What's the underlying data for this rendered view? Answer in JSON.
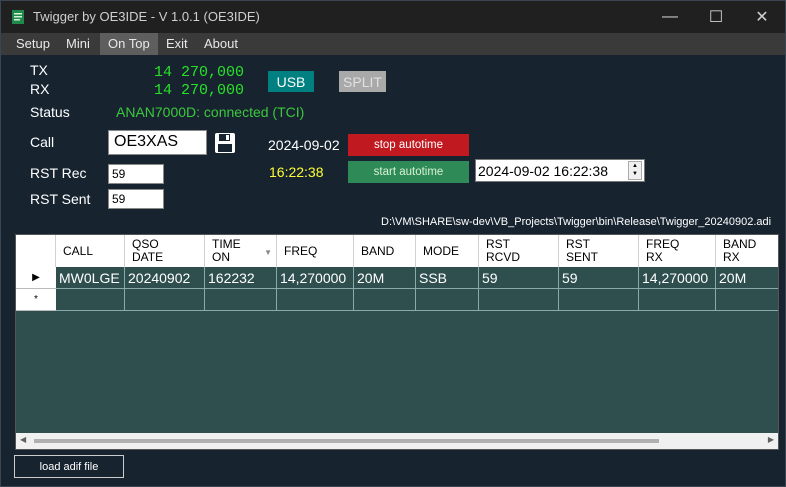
{
  "window": {
    "title": "Twigger by OE3IDE - V 1.0.1 (OE3IDE)"
  },
  "titlebar": {
    "minimize": "—",
    "maximize": "☐",
    "close": "✕"
  },
  "menu": [
    "Setup",
    "Mini",
    "On Top",
    "Exit",
    "About"
  ],
  "active_menu": "On Top",
  "radio": {
    "tx_label": "TX",
    "rx_label": "RX",
    "tx_freq": "14 270,000",
    "rx_freq": "14 270,000",
    "mode_button": "USB",
    "split_button": "SPLIT",
    "status_label": "Status",
    "status_value": "ANAN7000D: connected (TCI)"
  },
  "call": {
    "label": "Call",
    "value": "OE3XAS"
  },
  "rst": {
    "rec_label": "RST Rec",
    "rec_value": "59",
    "sent_label": "RST Sent",
    "sent_value": "59"
  },
  "autotime": {
    "date": "2024-09-02",
    "time": "16:22:38",
    "stop_label": "stop autotime",
    "start_label": "start autotime",
    "datetime_value": "2024-09-02 16:22:38"
  },
  "log_path": "D:\\VM\\SHARE\\sw-dev\\VB_Projects\\Twigger\\bin\\Release\\Twigger_20240902.adi",
  "grid": {
    "columns": [
      "CALL",
      "QSO DATE",
      "TIME ON",
      "FREQ",
      "BAND",
      "MODE",
      "RST RCVD",
      "RST SENT",
      "FREQ RX",
      "BAND RX"
    ],
    "columns_line1": [
      "CALL",
      "QSO",
      "TIME",
      "FREQ",
      "BAND",
      "MODE",
      "RST",
      "RST",
      "FREQ",
      "BAND"
    ],
    "columns_line2": [
      "",
      "DATE",
      "ON",
      "",
      "",
      "",
      "RCVD",
      "SENT",
      "RX",
      "RX"
    ],
    "rows": [
      [
        "MW0LGE",
        "20240902",
        "162232",
        "14,270000",
        "20M",
        "SSB",
        "59",
        "59",
        "14,270000",
        "20M"
      ]
    ],
    "current_row_marker": "▶",
    "new_row_marker": "*"
  },
  "footer": {
    "load_button": "load adif file"
  }
}
